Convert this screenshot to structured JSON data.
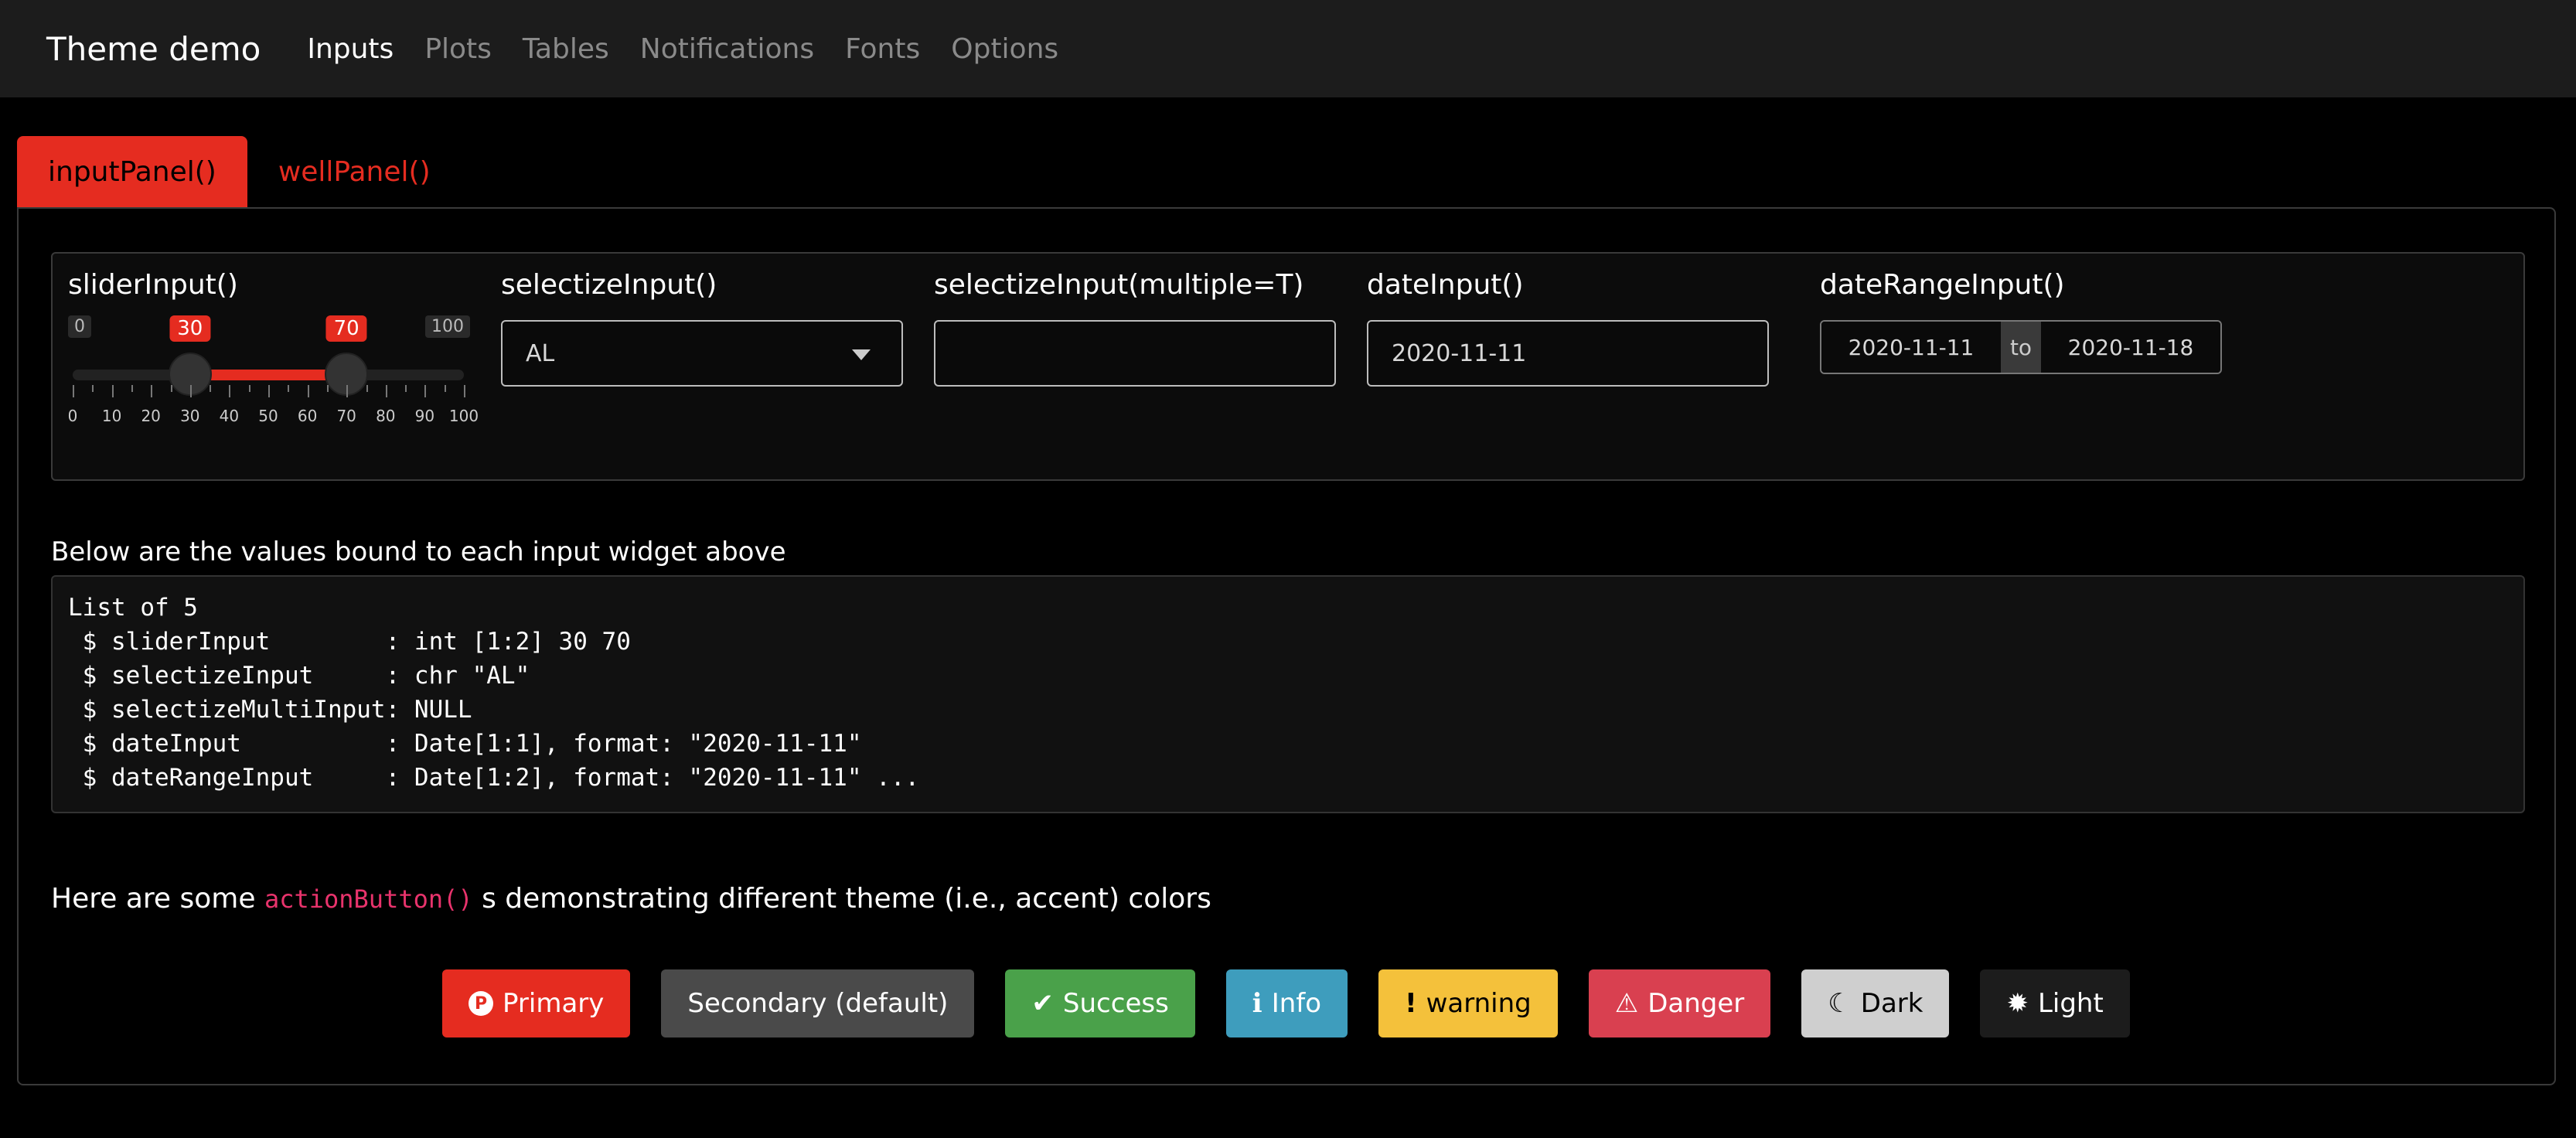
{
  "navbar": {
    "brand": "Theme demo",
    "items": [
      "Inputs",
      "Plots",
      "Tables",
      "Notifications",
      "Fonts",
      "Options"
    ]
  },
  "tabs": [
    "inputPanel()",
    "wellPanel()"
  ],
  "inputs": {
    "slider": {
      "label": "sliderInput()",
      "min_label": "0",
      "max_label": "100",
      "low": 30,
      "high": 70,
      "low_label": "30",
      "high_label": "70",
      "ticks": [
        "0",
        "10",
        "20",
        "30",
        "40",
        "50",
        "60",
        "70",
        "80",
        "90",
        "100"
      ]
    },
    "selectize": {
      "label": "selectizeInput()",
      "value": "AL"
    },
    "selectize_multi": {
      "label": "selectizeInput(multiple=T)",
      "value": ""
    },
    "date": {
      "label": "dateInput()",
      "value": "2020-11-11"
    },
    "daterange": {
      "label": "dateRangeInput()",
      "start": "2020-11-11",
      "separator": "to",
      "end": "2020-11-18"
    }
  },
  "output": {
    "heading": "Below are the values bound to each input widget above",
    "lines": [
      "List of 5",
      " $ sliderInput        : int [1:2] 30 70",
      " $ selectizeInput     : chr \"AL\"",
      " $ selectizeMultiInput: NULL",
      " $ dateInput          : Date[1:1], format: \"2020-11-11\"",
      " $ dateRangeInput     : Date[1:2], format: \"2020-11-11\" ..."
    ]
  },
  "buttons_section": {
    "prefix": "Here are some ",
    "code": "actionButton()",
    "suffix": " s demonstrating different theme (i.e., accent) colors"
  },
  "buttons": [
    {
      "label": "Primary",
      "icon": "P",
      "icon_name": "parking-icon",
      "bg": "#e52c20",
      "fg": "#ffffff"
    },
    {
      "label": "Secondary (default)",
      "icon": "",
      "icon_name": "",
      "bg": "#4a4a4a",
      "fg": "#ffffff"
    },
    {
      "label": "Success",
      "icon": "✔",
      "icon_name": "check-icon",
      "bg": "#4aa14a",
      "fg": "#ffffff"
    },
    {
      "label": "Info",
      "icon": "ℹ",
      "icon_name": "info-icon",
      "bg": "#3e9dbd",
      "fg": "#ffffff"
    },
    {
      "label": "warning",
      "icon": "!",
      "icon_name": "exclamation-icon",
      "bg": "#f4c13b",
      "fg": "#000000"
    },
    {
      "label": "Danger",
      "icon": "⚠",
      "icon_name": "warning-triangle-icon",
      "bg": "#d94050",
      "fg": "#ffffff"
    },
    {
      "label": "Dark",
      "icon": "☾",
      "icon_name": "moon-icon",
      "bg": "#cfcfcf",
      "fg": "#000000"
    },
    {
      "label": "Light",
      "icon": "✹",
      "icon_name": "sun-icon",
      "bg": "#1c1c1c",
      "fg": "#ffffff"
    }
  ],
  "colors": {
    "accent": "#e52c20",
    "navbar_bg": "#1c1c1c",
    "page_bg": "#000000"
  }
}
